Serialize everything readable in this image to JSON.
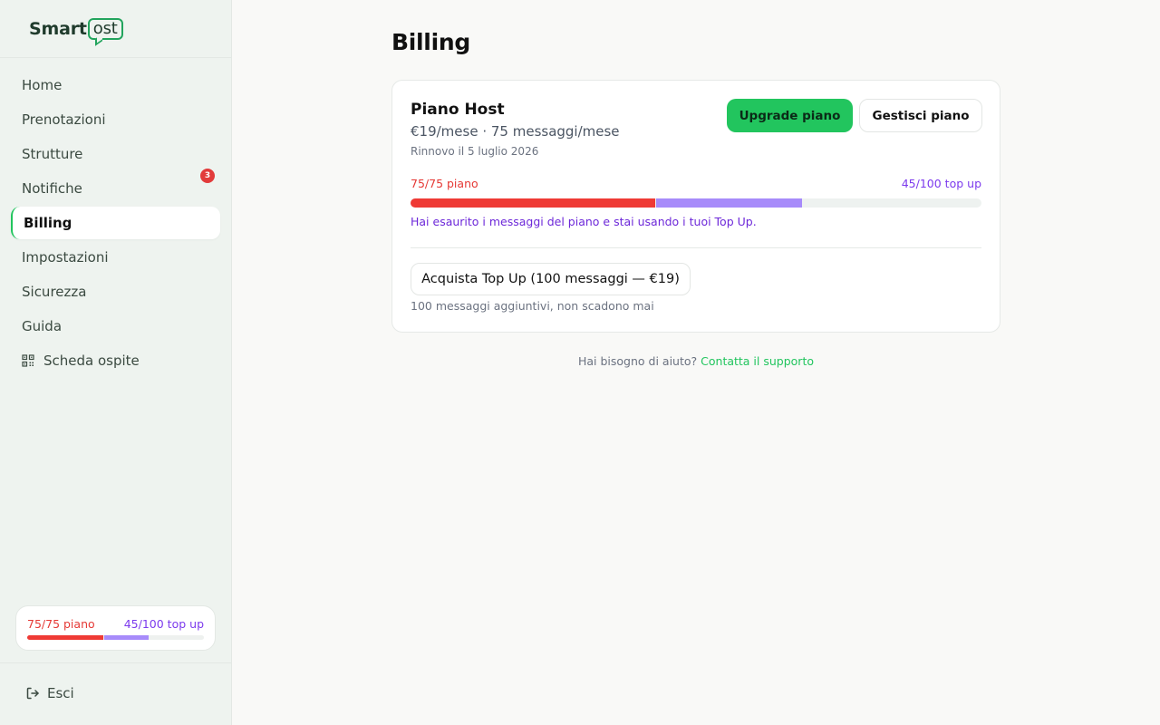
{
  "brand": {
    "smart": "Smart",
    "ost": "ost"
  },
  "sidebar": {
    "items": [
      {
        "label": "Home"
      },
      {
        "label": "Prenotazioni"
      },
      {
        "label": "Strutture"
      },
      {
        "label": "Notifiche",
        "badge": "3"
      },
      {
        "label": "Billing",
        "active": true
      },
      {
        "label": "Impostazioni"
      },
      {
        "label": "Sicurezza"
      },
      {
        "label": "Guida"
      },
      {
        "label": "Scheda ospite",
        "icon": "qr-code-icon"
      }
    ],
    "usage": {
      "plan_label": "75/75 piano",
      "topup_label": "45/100 top up"
    },
    "logout_label": "Esci"
  },
  "usage_values": {
    "plan_used": 75,
    "plan_total": 75,
    "topup_used": 45,
    "topup_total": 100
  },
  "page": {
    "title": "Billing"
  },
  "plan": {
    "name": "Piano Host",
    "price": "€19/mese · 75 messaggi/mese",
    "renewal": "Rinnovo il 5 luglio 2026",
    "upgrade_label": "Upgrade piano",
    "manage_label": "Gestisci piano",
    "plan_usage_label": "75/75 piano",
    "topup_usage_label": "45/100 top up",
    "note": "Hai esaurito i messaggi del piano e stai usando i tuoi Top Up.",
    "topup_button": "Acquista Top Up (100 messaggi — €19)",
    "topup_note": "100 messaggi aggiuntivi, non scadono mai"
  },
  "help": {
    "text": "Hai bisogno di aiuto?",
    "link": "Contatta il supporto"
  },
  "colors": {
    "accent": "#22c55e",
    "plan_red": "#ef3a35",
    "topup_purple": "#a78bfa",
    "topup_text": "#7c3aed",
    "badge": "#e23b3b"
  }
}
